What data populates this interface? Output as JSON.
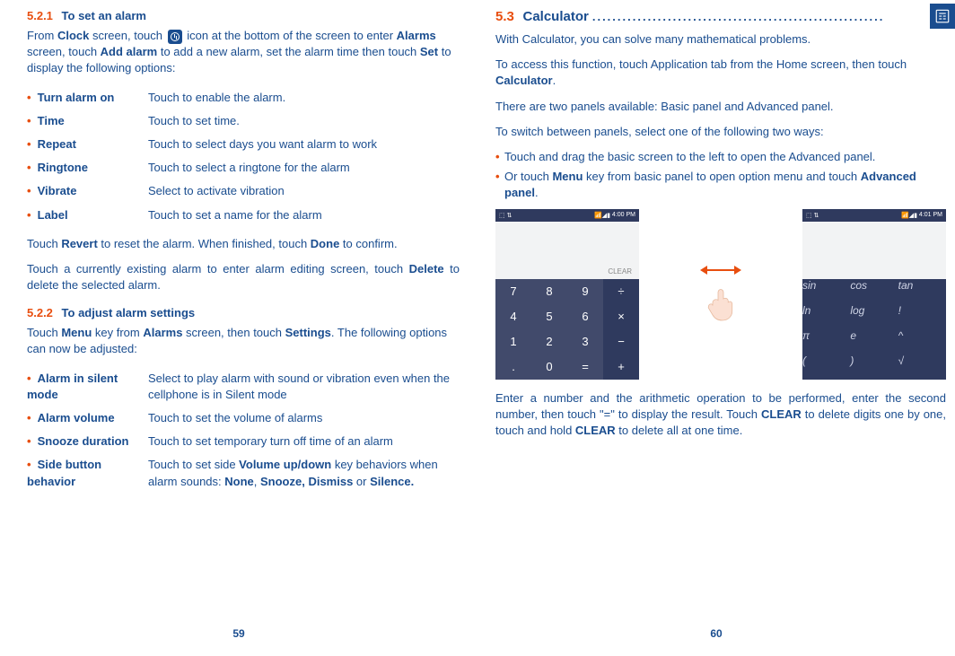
{
  "left": {
    "sec521_num": "5.2.1",
    "sec521_title": "To set an alarm",
    "intro_1a": "From ",
    "intro_1b": "Clock",
    "intro_1c": " screen, touch ",
    "intro_1d": " icon at the bottom of the screen to enter ",
    "intro_1e": "Alarms",
    "intro_1f": " screen, touch ",
    "intro_1g": "Add alarm",
    "intro_1h": " to add a new alarm, set the alarm time then touch ",
    "intro_1i": "Set",
    "intro_1j": " to display the following options:",
    "opts1": [
      {
        "name": "Turn alarm on",
        "desc": "Touch to enable the alarm."
      },
      {
        "name": "Time",
        "desc": "Touch to set time."
      },
      {
        "name": "Repeat",
        "desc": "Touch to select days you want alarm to work"
      },
      {
        "name": "Ringtone",
        "desc": "Touch to select a ringtone for the alarm"
      },
      {
        "name": "Vibrate",
        "desc": "Select to activate vibration"
      },
      {
        "name": "Label",
        "desc": "Touch to set a name for the alarm"
      }
    ],
    "revert_a": "Touch ",
    "revert_b": "Revert",
    "revert_c": " to reset the alarm. When finished, touch ",
    "revert_d": "Done",
    "revert_e": " to confirm.",
    "delete_a": "Touch a currently existing alarm to enter alarm editing screen, touch ",
    "delete_b": "Delete",
    "delete_c": " to delete the selected alarm.",
    "sec522_num": "5.2.2",
    "sec522_title": "To adjust alarm settings",
    "adjust_a": "Touch ",
    "adjust_b": "Menu",
    "adjust_c": " key from ",
    "adjust_d": "Alarms",
    "adjust_e": " screen, then touch ",
    "adjust_f": "Settings",
    "adjust_g": ". The following options can now be adjusted:",
    "opts2": [
      {
        "name": "Alarm in silent mode",
        "desc": "Select to play alarm with sound or vibration even when the cellphone is in Silent mode"
      },
      {
        "name": "Alarm volume",
        "desc": "Touch to set the volume of alarms"
      },
      {
        "name": "Snooze duration",
        "desc": "Touch to set temporary turn off time of an alarm"
      },
      {
        "name": "Side button behavior",
        "desc_a": "Touch to set side ",
        "desc_b": "Volume up/down",
        "desc_c": " key behaviors when alarm sounds: ",
        "desc_d": "None",
        "desc_e": ", ",
        "desc_f": "Snooze, Dismiss",
        "desc_g": " or ",
        "desc_h": "Silence."
      }
    ],
    "pagenum": "59"
  },
  "right": {
    "sec53_num": "5.3",
    "sec53_title": "Calculator",
    "p1": "With Calculator, you can solve many mathematical problems.",
    "p2_a": "To access this function, touch Application tab from the Home screen, then touch ",
    "p2_b": "Calculator",
    "p2_c": ".",
    "p3": "There are two panels available: Basic panel and Advanced panel.",
    "p4": "To switch between panels, select one of the following two ways:",
    "b1": "Touch and drag the basic screen to the left to open the Advanced panel.",
    "b2_a": "Or touch ",
    "b2_b": "Menu",
    "b2_c": " key from basic panel to open option menu and touch ",
    "b2_d": "Advanced panel",
    "b2_e": ".",
    "clear_label": "CLEAR",
    "time1": "4:00 PM",
    "time2": "4:01 PM",
    "basic_keys": [
      [
        "7",
        "num"
      ],
      [
        "8",
        "num"
      ],
      [
        "9",
        "num"
      ],
      [
        "÷",
        "op"
      ],
      [
        "4",
        "num"
      ],
      [
        "5",
        "num"
      ],
      [
        "6",
        "num"
      ],
      [
        "×",
        "op"
      ],
      [
        "1",
        "num"
      ],
      [
        "2",
        "num"
      ],
      [
        "3",
        "num"
      ],
      [
        "−",
        "op"
      ],
      [
        ".",
        "num"
      ],
      [
        "0",
        "num"
      ],
      [
        "=",
        "num"
      ],
      [
        "+",
        "op"
      ]
    ],
    "adv_keys": [
      "sin",
      "cos",
      "tan",
      "ln",
      "log",
      "!",
      "π",
      "e",
      "^",
      "(",
      ")",
      "√"
    ],
    "p5_a": "Enter a number and the arithmetic operation to be performed, enter the second number, then touch \"=\" to display the result. Touch ",
    "p5_b": "CLEAR",
    "p5_c": " to delete digits one by one, touch and hold ",
    "p5_d": "CLEAR",
    "p5_e": " to delete all at one time.",
    "pagenum": "60"
  }
}
